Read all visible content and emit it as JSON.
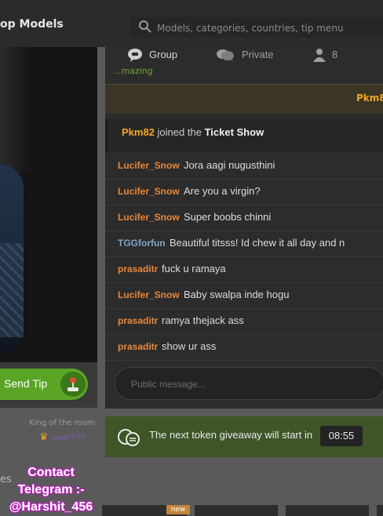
{
  "header": {
    "brand": "op Models",
    "search_placeholder": "Models, categories, countries, tip menu"
  },
  "tabs": [
    {
      "label": "Group",
      "icon": "chat-bubble-icon"
    },
    {
      "label": "Private",
      "icon": "private-chat-icon"
    },
    {
      "label": "8",
      "icon": "user-icon"
    }
  ],
  "chat": {
    "clipped_top_text": "...mazing",
    "notice_name": "Pkm8",
    "joined": {
      "name": "Pkm82",
      "middle": "joined the",
      "show": "Ticket Show"
    },
    "messages": [
      {
        "user": "Lucifer_Snow",
        "text": "Jora aagi nugusthini",
        "color": "#e8873a"
      },
      {
        "user": "Lucifer_Snow",
        "text": "Are you a virgin?",
        "color": "#e8873a"
      },
      {
        "user": "Lucifer_Snow",
        "text": "Super boobs chinni",
        "color": "#e8873a"
      },
      {
        "user": "TGGforfun",
        "text": "Beautiful titsss! Id chew it all day and n",
        "color": "#7fa6c9"
      },
      {
        "user": "prasaditr",
        "text": "fuck u ramaya",
        "color": "#e8873a"
      },
      {
        "user": "Lucifer_Snow",
        "text": "Baby swalpa inde hogu",
        "color": "#e8873a"
      },
      {
        "user": "prasaditr",
        "text": "ramya thejack ass",
        "color": "#e8873a"
      },
      {
        "user": "prasaditr",
        "text": "show ur ass",
        "color": "#e8873a"
      }
    ],
    "input_placeholder": "Public message..."
  },
  "tip": {
    "label": "Send Tip"
  },
  "king": {
    "label": "King of the room:",
    "user": "user777"
  },
  "giveaway": {
    "text": "The next token giveaway will start in",
    "timer": "08:55"
  },
  "bottom": {
    "section": "es",
    "badge": "new"
  },
  "watermark": {
    "line1": "Contact",
    "line2": "Telegram :-",
    "line3": "@Harshit_456"
  }
}
